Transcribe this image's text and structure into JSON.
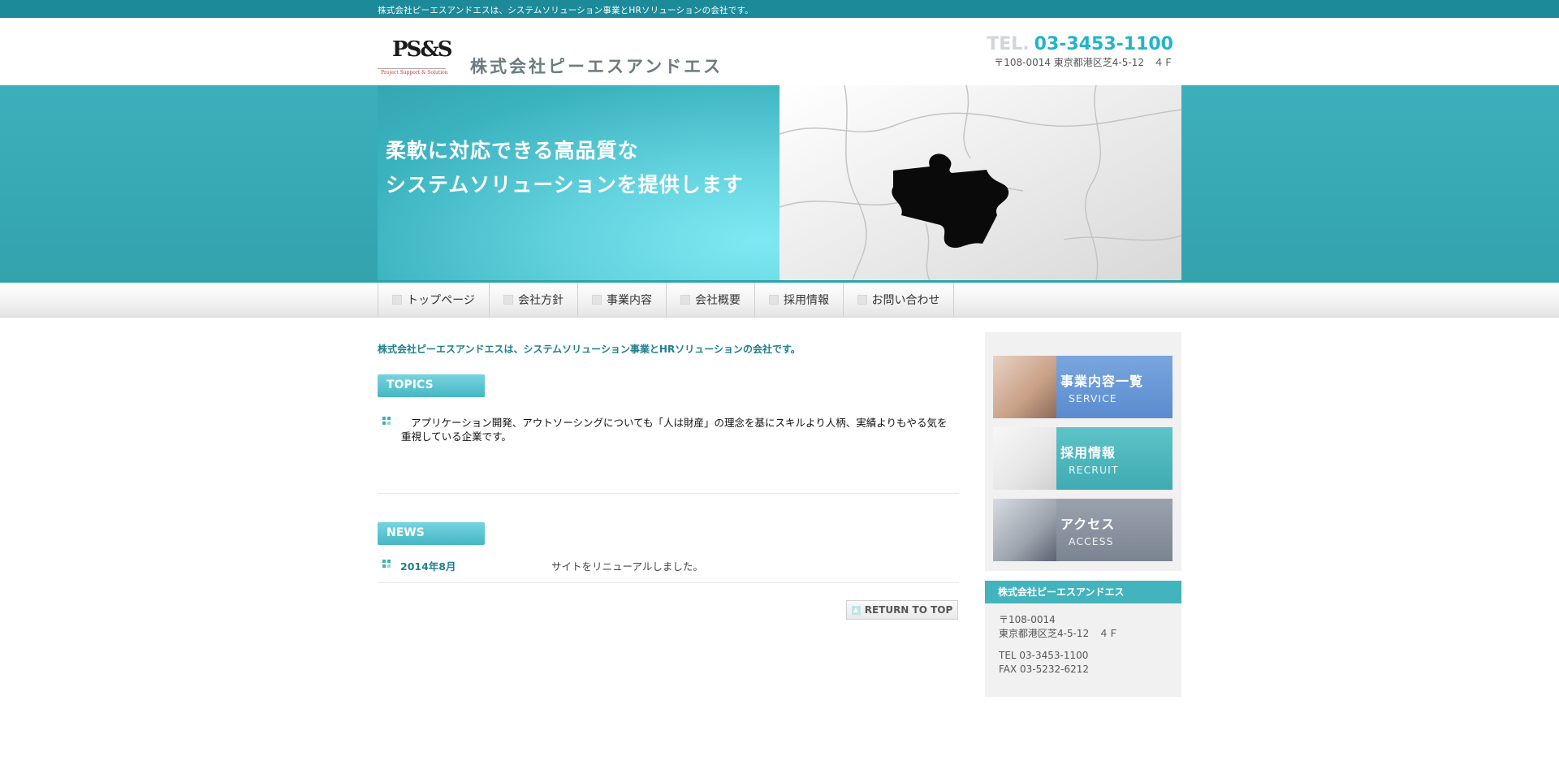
{
  "topbar": {
    "text": "株式会社ピーエスアンドエスは、システムソリューション事業とHRソリューションの会社です。"
  },
  "header": {
    "logo_mark": "PS&S",
    "logo_tagline": "Project Support & Solution",
    "company_name": "株式会社ピーエスアンドエス",
    "tel_label": "TEL.",
    "tel_number": "03-3453-1100",
    "address": "〒108-0014 東京都港区芝4-5-12　４Ｆ"
  },
  "hero": {
    "line1": "柔軟に対応できる高品質な",
    "line2": "システムソリューションを提供します"
  },
  "nav": {
    "items": [
      {
        "label": "トップページ"
      },
      {
        "label": "会社方針"
      },
      {
        "label": "事業内容"
      },
      {
        "label": "会社概要"
      },
      {
        "label": "採用情報"
      },
      {
        "label": "お問い合わせ"
      }
    ]
  },
  "main": {
    "intro": "株式会社ピーエスアンドエスは、システムソリューション事業とHRソリューションの会社です。",
    "topics_title": "TOPICS",
    "topic_text": "アプリケーション開発、アウトソーシングについても「人は財産」の理念を基にスキルより人柄、実績よりもやる気を重視している企業です。",
    "news_title": "NEWS",
    "news": [
      {
        "date": "2014年8月",
        "text": "サイトをリニューアルしました。"
      }
    ],
    "return_top": "RETURN TO TOP"
  },
  "sidebar": {
    "banners": [
      {
        "jp": "事業内容一覧",
        "en": "SERVICE"
      },
      {
        "jp": "採用情報",
        "en": "RECRUIT"
      },
      {
        "jp": "アクセス",
        "en": "ACCESS"
      }
    ],
    "info": {
      "title": "株式会社ピーエスアンドエス",
      "postal": "〒108-0014",
      "address": "東京都港区芝4-5-12　４Ｆ",
      "tel": "TEL 03-3453-1100",
      "fax": "FAX 03-5232-6212"
    }
  }
}
